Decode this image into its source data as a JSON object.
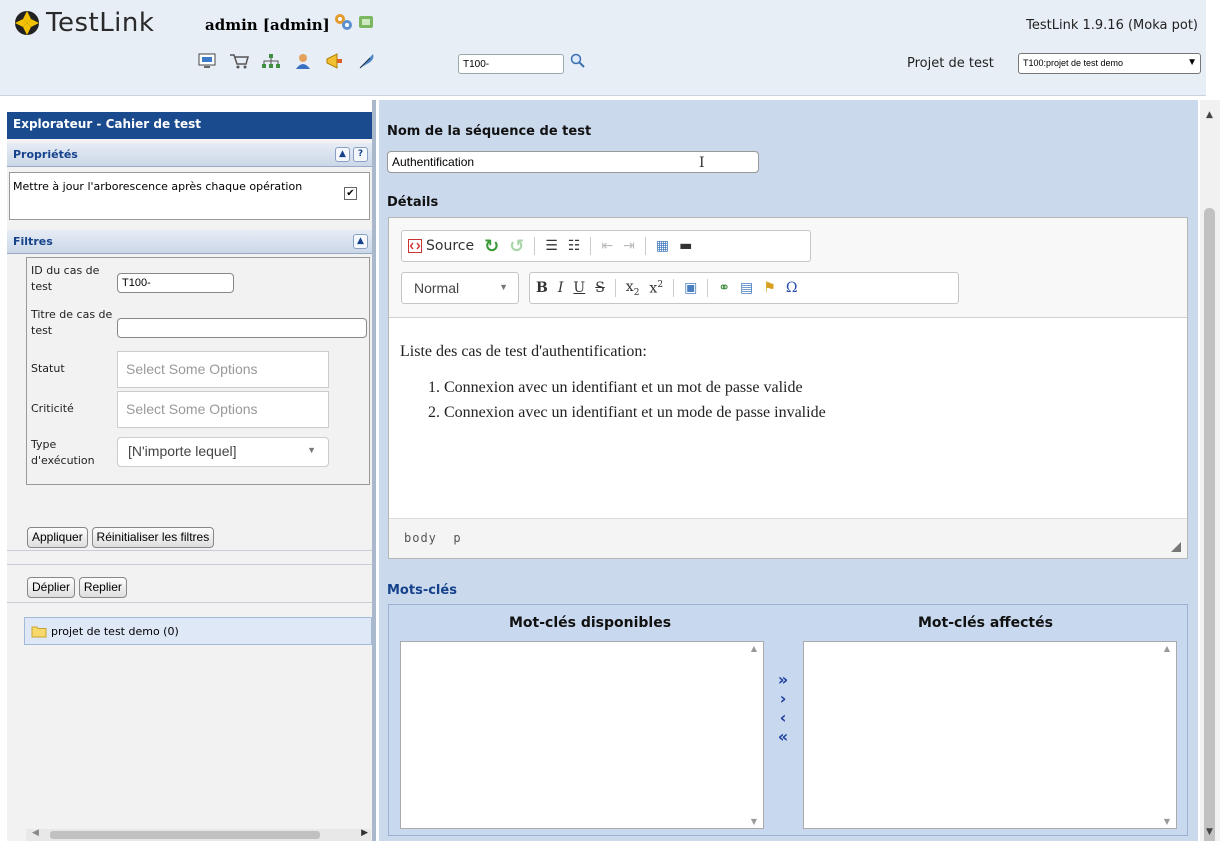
{
  "header": {
    "app_name": "TestLink",
    "user": "admin [admin]",
    "version": "TestLink 1.9.16 (Moka pot)",
    "tc_search_value": "T100-",
    "project_label": "Projet de test",
    "project_selected": "T100:projet de test demo",
    "toolbar_icons": [
      "desktop-icon",
      "cart-icon",
      "sitemap-icon",
      "user-icon",
      "megaphone-icon",
      "feather-icon"
    ]
  },
  "left": {
    "title": "Explorateur - Cahier de test",
    "properties": {
      "header": "Propriétés",
      "update_tree_label": "Mettre à jour l'arborescence après chaque opération",
      "update_tree_checked": true
    },
    "filters": {
      "header": "Filtres",
      "tc_id_label": "ID du cas de test",
      "tc_id_value": "T100-",
      "tc_title_label": "Titre de cas de test",
      "tc_title_value": "",
      "status_label": "Statut",
      "status_placeholder": "Select Some Options",
      "priority_label": "Criticité",
      "priority_placeholder": "Select Some Options",
      "exec_type_label": "Type d'exécution",
      "exec_type_value": "[N'importe lequel]"
    },
    "apply_button": "Appliquer",
    "reset_button": "Réinitialiser les filtres",
    "expand_button": "Déplier",
    "collapse_button": "Replier",
    "tree_root": "projet de test demo (0)"
  },
  "right": {
    "name_label": "Nom de la séquence de test",
    "name_value": "Authentification",
    "details_label": "Détails",
    "editor": {
      "source_label": "Source",
      "format_value": "Normal",
      "intro": "Liste des cas de test d'authentification:",
      "items": [
        "Connexion avec un identifiant et un mot de passe valide",
        "Connexion avec un identifiant et un mode de passe invalide"
      ],
      "path": "body  p"
    },
    "keywords_label": "Mots-clés",
    "available_label": "Mot-clés disponibles",
    "assigned_label": "Mot-clés affectés"
  },
  "colors": {
    "header_bg": "#e8eef6",
    "left_title_bg": "#1a4b8f",
    "right_bg": "#cbd9ed",
    "keyword_title": "#15428b"
  }
}
